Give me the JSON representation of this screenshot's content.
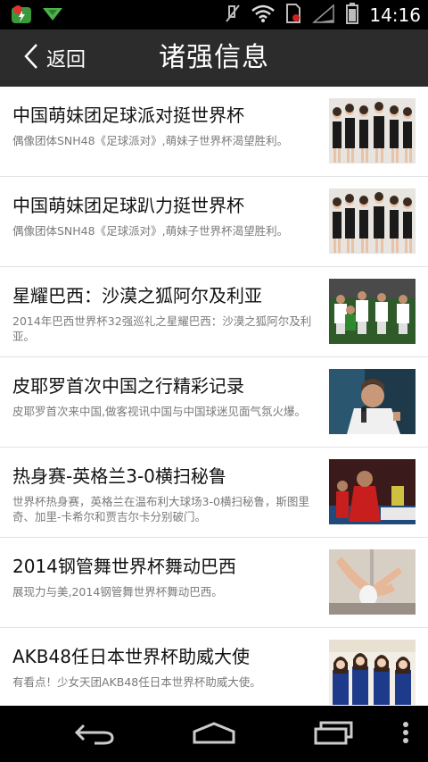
{
  "status_bar": {
    "time": "14:16",
    "icons": [
      "app-icon",
      "notification-icon",
      "mute-icon",
      "wifi-icon",
      "sim-icon",
      "signal-icon",
      "battery-icon"
    ]
  },
  "header": {
    "back_label": "返回",
    "title": "诸强信息"
  },
  "news": [
    {
      "title": "中国萌妹团足球派对挺世界杯",
      "desc": "偶像团体SNH48《足球派对》,萌妹子世界杯渴望胜利。"
    },
    {
      "title": "中国萌妹团足球趴力挺世界杯",
      "desc": "偶像团体SNH48《足球派对》,萌妹子世界杯渴望胜利。"
    },
    {
      "title": "星耀巴西：沙漠之狐阿尔及利亚",
      "desc": "2014年巴西世界杯32强巡礼之星耀巴西：沙漠之狐阿尔及利亚。"
    },
    {
      "title": "皮耶罗首次中国之行精彩记录",
      "desc": "皮耶罗首次来中国,做客视讯中国与中国球迷见面气氛火爆。"
    },
    {
      "title": "热身赛-英格兰3-0横扫秘鲁",
      "desc": "世界杯热身赛，英格兰在温布利大球场3-0横扫秘鲁，斯图里奇、加里-卡希尔和贾吉尔卡分别破门。"
    },
    {
      "title": "2014钢管舞世界杯舞动巴西",
      "desc": "展现力与美,2014钢管舞世界杯舞动巴西。"
    },
    {
      "title": "AKB48任日本世界杯助威大使",
      "desc": "有看点！少女天团AKB48任日本世界杯助威大使。"
    }
  ],
  "colors": {
    "header_bg": "#2c2c2c",
    "divider": "#e2e2e2",
    "desc_text": "#7a7a7a"
  }
}
